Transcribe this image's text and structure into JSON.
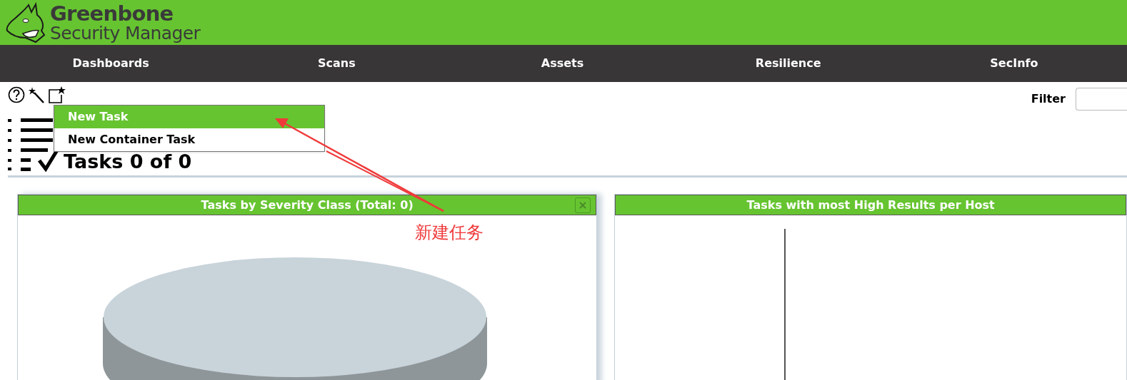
{
  "logo": {
    "line_1": "Greenbone",
    "line_2": "Security Manager"
  },
  "nav": [
    {
      "label": "Dashboards"
    },
    {
      "label": "Scans"
    },
    {
      "label": "Assets"
    },
    {
      "label": "Resilience"
    },
    {
      "label": "SecInfo"
    }
  ],
  "new_menu": [
    {
      "label": "New Task",
      "selected": true
    },
    {
      "label": "New Container Task",
      "selected": false
    }
  ],
  "page_title": "Tasks 0 of 0",
  "filter": {
    "label": "Filter"
  },
  "panels": [
    {
      "title": "Tasks by Severity Class (Total: 0)",
      "kind": "pie"
    },
    {
      "title": "Tasks with most High Results per Host",
      "kind": "bar"
    }
  ],
  "annotation": {
    "text": "新建任务"
  }
}
